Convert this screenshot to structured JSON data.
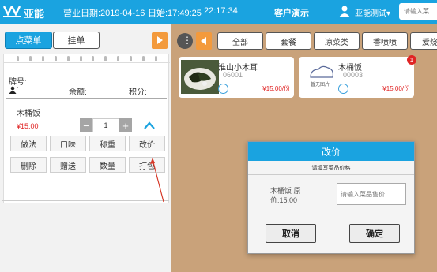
{
  "header": {
    "brand": "亚能",
    "biz_date": "营业日期:2019-04-16",
    "day_time": "日始:17:49:25",
    "clock": "22:17:34",
    "mode": "客户演示",
    "user": "亚能测试▾",
    "search_placeholder": "请输入菜"
  },
  "left": {
    "tabs": {
      "order": "点菜单",
      "hold": "挂单"
    },
    "plate_label": "牌号:",
    "person_sep": ":",
    "balance_label": "余额:",
    "points_label": "积分:",
    "item": {
      "name": "木桶饭",
      "price": "¥15.00",
      "qty": "1"
    },
    "actions": [
      "做法",
      "口味",
      "称重",
      "改价",
      "删除",
      "赠送",
      "数量",
      "打包"
    ]
  },
  "categories": [
    "全部",
    "套餐",
    "凉菜类",
    "香喷喷",
    "爱烧"
  ],
  "dishes": [
    {
      "name": "淮山小木耳",
      "code": "06001",
      "price": "¥15.00/份",
      "badge": ""
    },
    {
      "name": "木桶饭",
      "code": "00003",
      "price": "¥15.00/份",
      "badge": "1",
      "placeholder_text": "暂无图片"
    }
  ],
  "modal": {
    "title": "改价",
    "subtitle": "请填写菜品价格",
    "info_line1": "木桶饭 原",
    "info_line2": "价:15.00",
    "input_placeholder": "请输入菜品售价",
    "cancel": "取消",
    "confirm": "确定"
  },
  "colors": {
    "accent": "#1aa3e0",
    "orange": "#f39a3c",
    "price": "#e02424"
  }
}
